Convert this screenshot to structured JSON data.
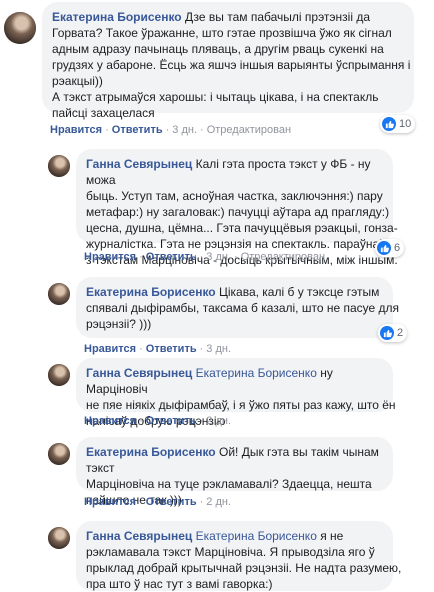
{
  "comments": [
    {
      "author": "Екатерина Борисенко",
      "lines": [
        "Дзе вы там пабачылі прэтэнзіі да",
        "Горвата? Такое ўражанне, што гэтае прозвішча ўжо як сігнал",
        "адным адразу пачынаць пляваць, а другім рваць сукенкі на",
        "грудзях у абароне. Ёсць жа яшчэ іншыя варыянты ўспрымання і",
        "рэакцыі))",
        "А тэкст атрымаўся харошы: і чытаць цікава, і на спектакль",
        "пайсці захацелася"
      ],
      "like": "Нравится",
      "reply": "Ответить",
      "time": "3 дн.",
      "edited": "Отредактирован",
      "reactions": "10"
    },
    {
      "author": "Ганна Севярынец",
      "lines_first": "Калі гэта проста тэкст у ФБ - ну можа",
      "lines": [
        "быць. Уступ там, аснoўная частка, заключэння:) пару",
        "метафар:) ну загаловак:) пачуцці аўтара ад прагляду:)",
        "цесна, душна, цёмна... Гэта пачуццёвыя рэакцыі, гонза-",
        "журналістка. Гэта не рэцэнзія на спектакль. параўнайце",
        "з тэкстам Марціновіча - досыць крытычным, між іншым."
      ],
      "like": "Нравится",
      "reply": "Ответить",
      "time": "3 дн.",
      "edited": "Отредактирован",
      "reactions": "6"
    },
    {
      "author": "Екатерина Борисенко",
      "lines_first": "Цікава, калі б у тэксце гэтым",
      "lines": [
        "спявалі дыфірамбы, таксама б казалі, што не пасуе для",
        "рэцэнзіі? )))"
      ],
      "like": "Нравится",
      "reply": "Ответить",
      "time": "3 дн.",
      "reactions": "2"
    },
    {
      "author": "Ганна Севярынец",
      "mention": "Екатерина Борисенко",
      "lines_first": "ну Марціновіч",
      "lines": [
        "не пяе ніякіх дыфірамбаў, і я ўжо пяты раз кажу, што ён",
        "напісаў добрую рэцэнзію"
      ],
      "like": "Нравится",
      "reply": "Ответить",
      "time": "2 дн."
    },
    {
      "author": "Екатерина Борисенко",
      "lines_first": "Ой! Дык гэта вы такім чынам тэкст",
      "lines": [
        "Марціновіча на туце рэкламавалі? Здаецца, нешта",
        "пайшло не так )))"
      ],
      "like": "Нравится",
      "reply": "Ответить",
      "time": "2 дн."
    },
    {
      "author": "Ганна Севярынец",
      "mention": "Екатерина Борисенко",
      "lines_first": "я не",
      "lines": [
        "рэкламавала тэкст Марціновіча. Я прыводзіла яго ў",
        "прыклад добрай крытычнай рэцэнзіі. Не надта разумею,",
        "пра што ў нас тут з вамі гаворка:)"
      ]
    }
  ],
  "colors": {
    "link": "#385898",
    "bubble": "#f2f3f5",
    "meta": "#90949c",
    "like": "#1877f2"
  }
}
